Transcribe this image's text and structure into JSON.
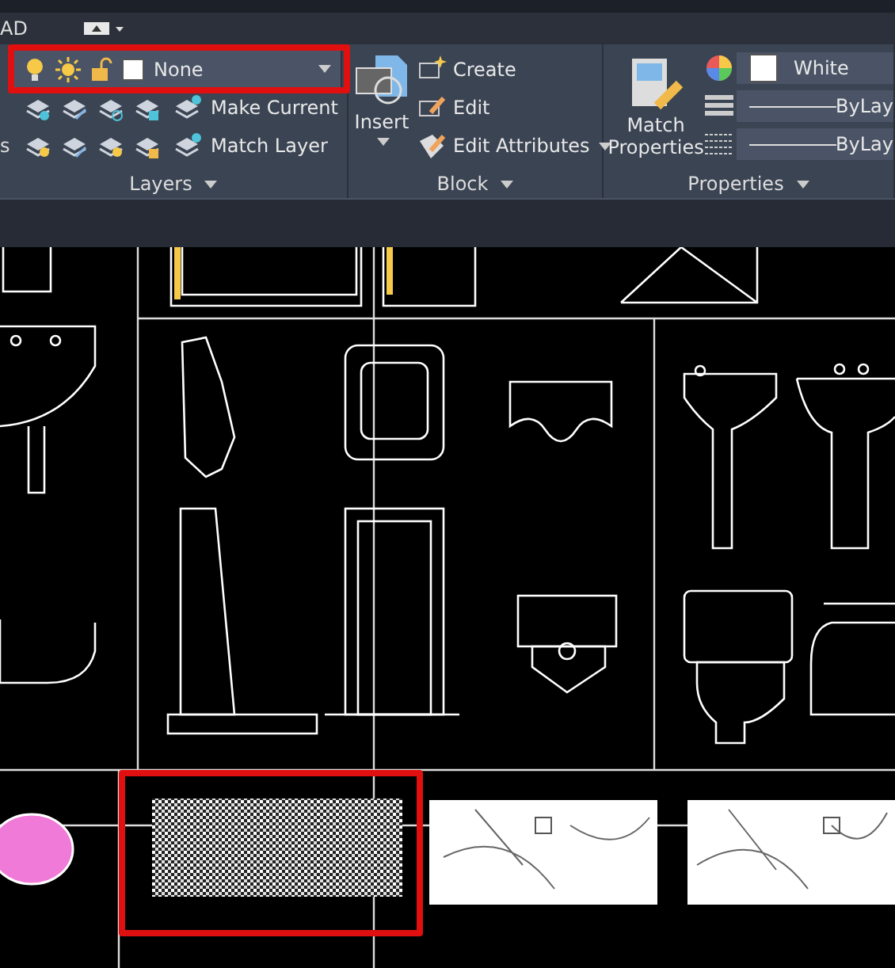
{
  "quick_access": {
    "app_label": "AD"
  },
  "ribbon": {
    "layers": {
      "cut_label": "s",
      "layer_control": {
        "name": "None",
        "color": "#ffffff",
        "highlighted": true
      },
      "tools": [
        {
          "label": "Make Current"
        },
        {
          "label": "Match Layer"
        }
      ],
      "title": "Layers"
    },
    "block": {
      "insert": "Insert",
      "tools": [
        {
          "label": "Create"
        },
        {
          "label": "Edit"
        },
        {
          "label": "Edit Attributes"
        }
      ],
      "title": "Block"
    },
    "properties": {
      "match": "Match Properties",
      "color_control": {
        "name": "White",
        "color": "#ffffff"
      },
      "linetype": "ByLay",
      "lineweight": "ByLay",
      "title": "Properties"
    }
  },
  "drawing": {
    "hatch_block": {
      "highlighted": true
    }
  }
}
